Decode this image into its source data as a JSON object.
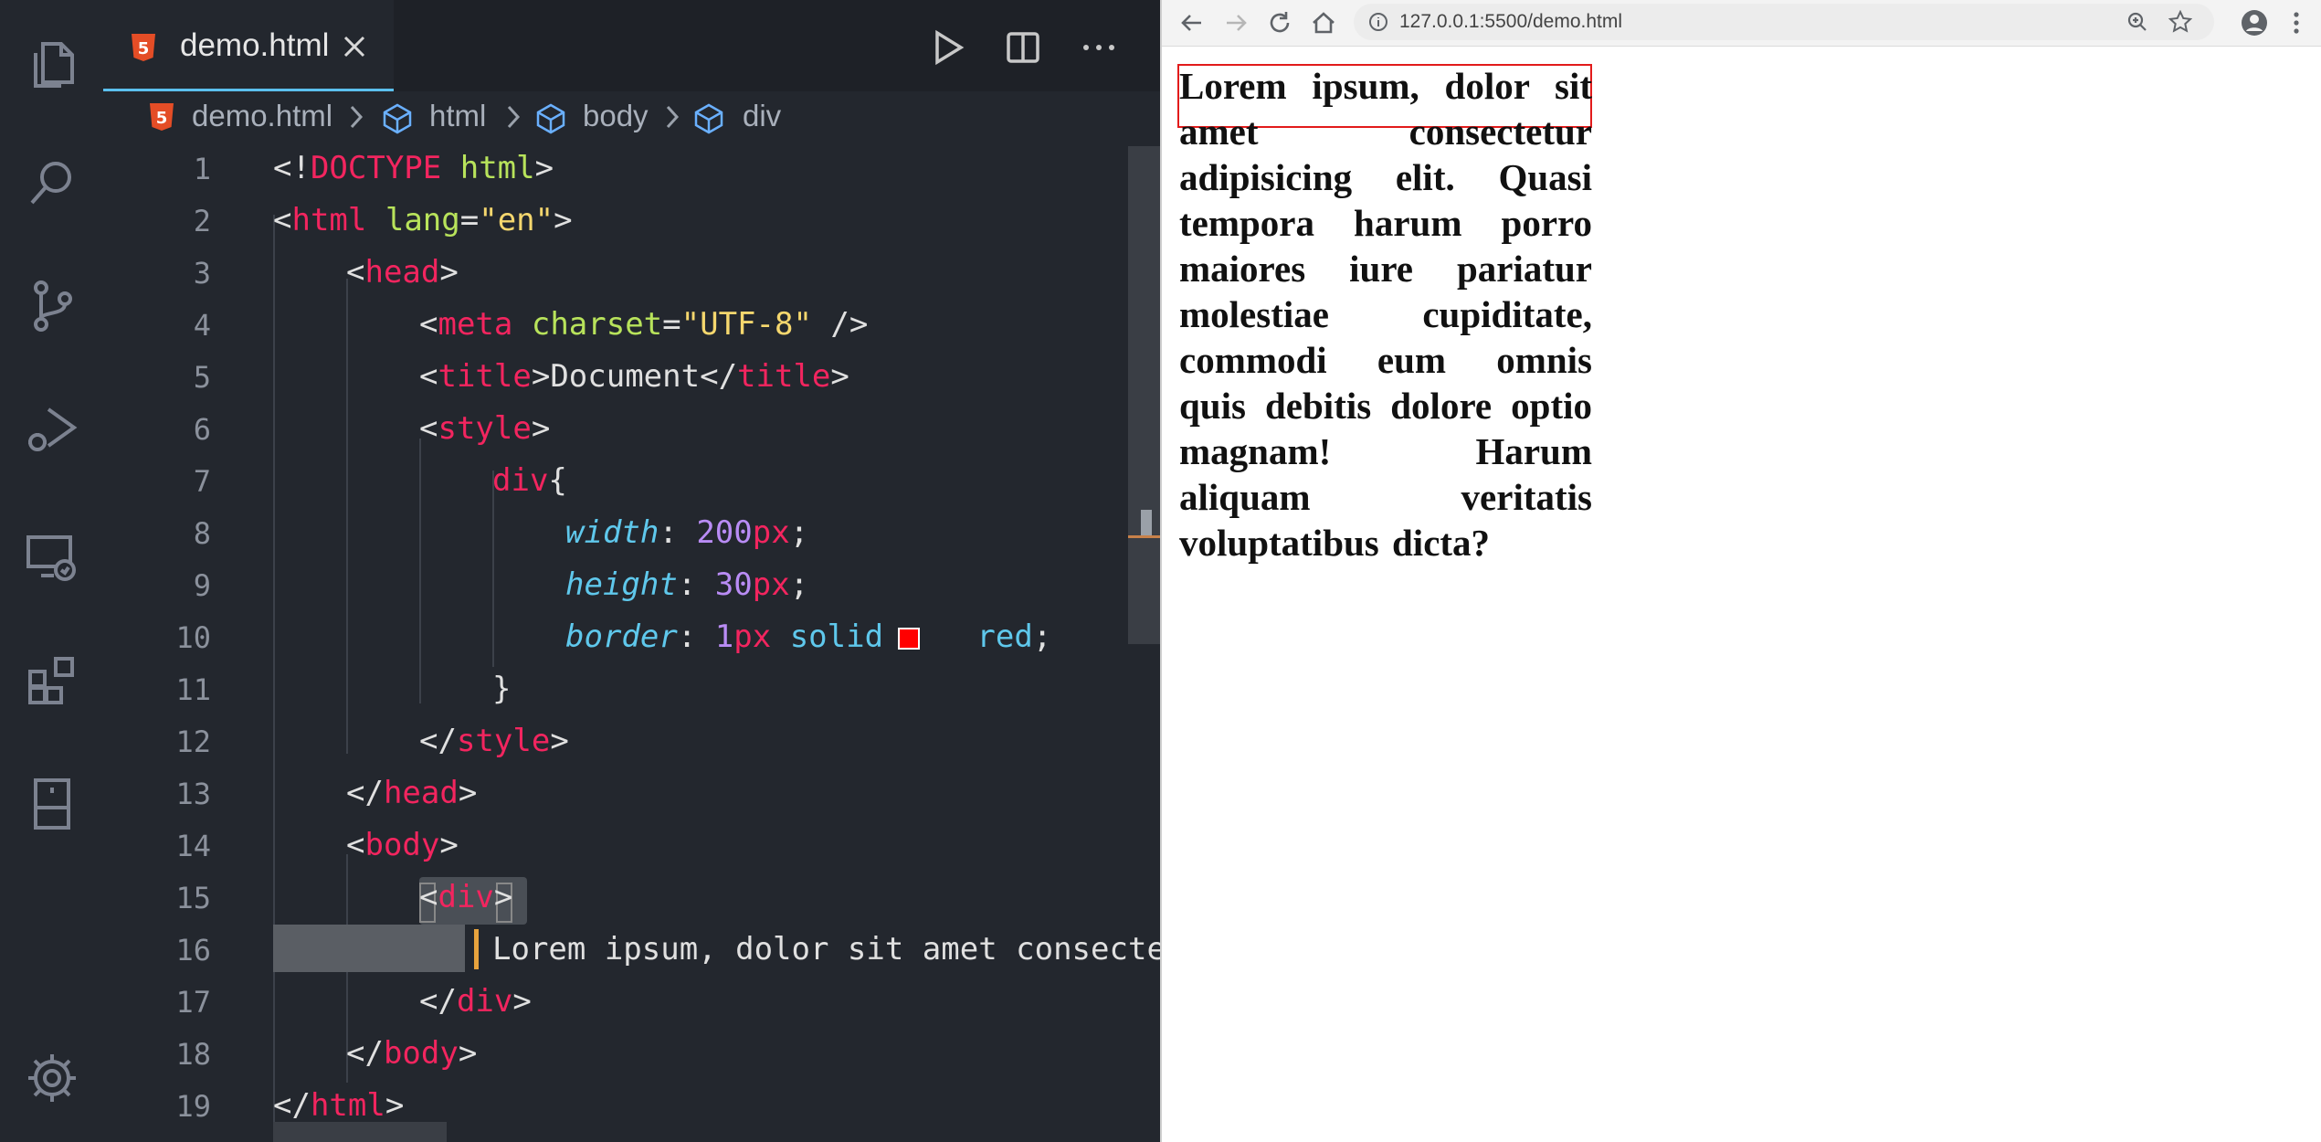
{
  "editor": {
    "tab": {
      "filename": "demo.html"
    },
    "breadcrumb": [
      "demo.html",
      "html",
      "body",
      "div"
    ],
    "lines": [
      {
        "n": "1"
      },
      {
        "n": "2"
      },
      {
        "n": "3"
      },
      {
        "n": "4"
      },
      {
        "n": "5"
      },
      {
        "n": "6"
      },
      {
        "n": "7"
      },
      {
        "n": "8"
      },
      {
        "n": "9"
      },
      {
        "n": "10"
      },
      {
        "n": "11"
      },
      {
        "n": "12"
      },
      {
        "n": "13"
      },
      {
        "n": "14"
      },
      {
        "n": "15"
      },
      {
        "n": "16"
      },
      {
        "n": "17"
      },
      {
        "n": "18"
      },
      {
        "n": "19"
      }
    ],
    "code": {
      "doctype_kw": "DOCTYPE",
      "doctype_val": "html",
      "html_tag": "html",
      "lang_attr": "lang",
      "lang_val": "\"en\"",
      "head_tag": "head",
      "meta_tag": "meta",
      "charset_attr": "charset",
      "charset_val": "\"UTF-8\"",
      "title_tag": "title",
      "title_text": "Document",
      "style_tag": "style",
      "selector": "div",
      "width_prop": "width",
      "width_num": "200",
      "width_unit": "px",
      "height_prop": "height",
      "height_num": "30",
      "height_unit": "px",
      "border_prop": "border",
      "border_num": "1",
      "border_unit": "px",
      "border_style": "solid",
      "border_color": "red",
      "body_tag": "body",
      "div_tag": "div",
      "text_line": "Lorem ipsum, dolor sit amet consectet"
    },
    "icons": [
      "files-icon",
      "search-icon",
      "source-control-icon",
      "run-debug-icon",
      "remote-explorer-icon",
      "extensions-icon",
      "device-icon",
      "settings-gear-icon"
    ],
    "toolbar_icons": [
      "run-icon",
      "split-editor-icon",
      "more-actions-icon"
    ]
  },
  "browser": {
    "url": "127.0.0.1:5500/demo.html",
    "page_text": "Lorem ipsum, dolor sit amet consectetur adipisicing elit. Quasi tempora harum porro maiores iure pariatur molestiae cupiditate, commodi eum omnis quis debitis dolore optio magnam! Harum aliquam veritatis voluptatibus dicta?",
    "box_border_color": "#e21b1b"
  }
}
